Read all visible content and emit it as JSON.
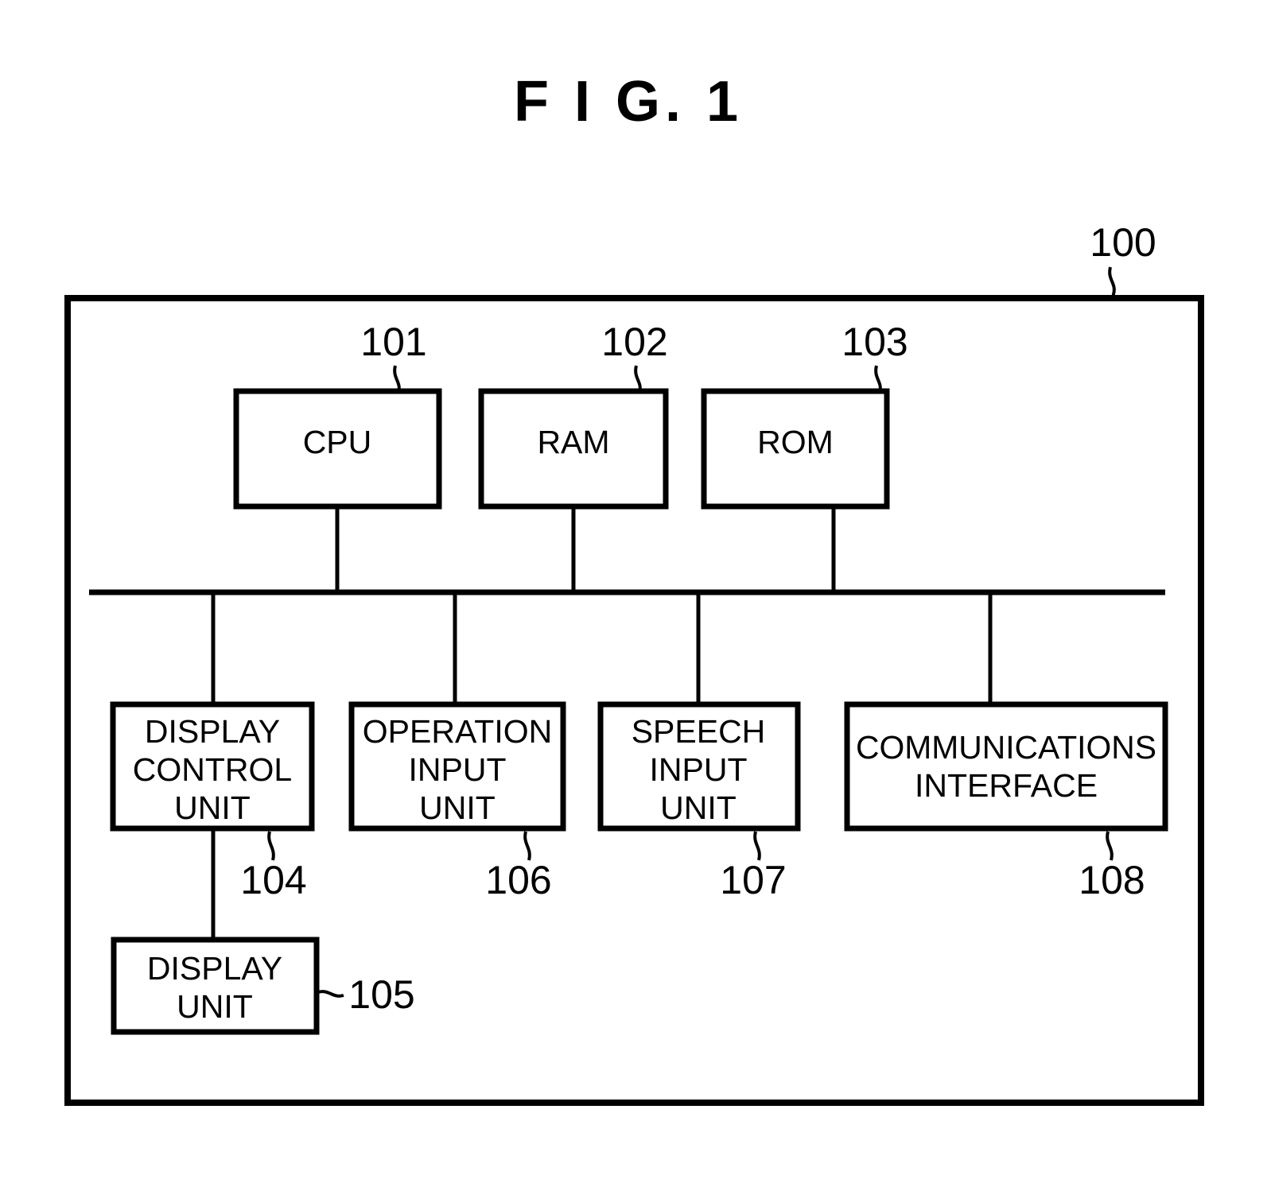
{
  "figure": {
    "title": "F I G. 1",
    "system_ref": "100"
  },
  "blocks": {
    "cpu": {
      "label": "CPU",
      "ref": "101"
    },
    "ram": {
      "label": "RAM",
      "ref": "102"
    },
    "rom": {
      "label": "ROM",
      "ref": "103"
    },
    "display_control_unit": {
      "line1": "DISPLAY",
      "line2": "CONTROL",
      "line3": "UNIT",
      "ref": "104"
    },
    "display_unit": {
      "line1": "DISPLAY",
      "line2": "UNIT",
      "ref": "105"
    },
    "operation_input_unit": {
      "line1": "OPERATION",
      "line2": "INPUT",
      "line3": "UNIT",
      "ref": "106"
    },
    "speech_input_unit": {
      "line1": "SPEECH",
      "line2": "INPUT",
      "line3": "UNIT",
      "ref": "107"
    },
    "communications_interface": {
      "line1": "COMMUNICATIONS",
      "line2": "INTERFACE",
      "ref": "108"
    }
  },
  "colors": {
    "ink": "#000000",
    "paper": "#ffffff"
  }
}
